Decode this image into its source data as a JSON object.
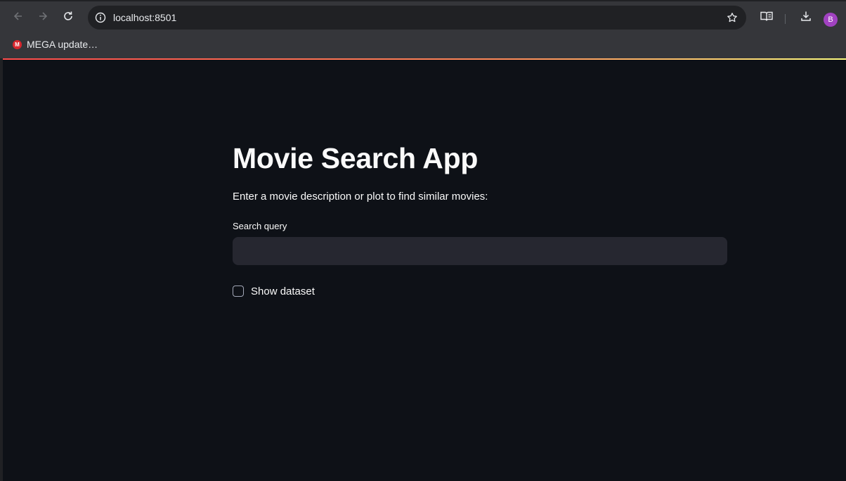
{
  "browser": {
    "url": "localhost:8501",
    "icons": {
      "back": "back-arrow-icon",
      "forward": "forward-arrow-icon",
      "reload": "reload-icon",
      "site_info": "site-info-icon",
      "bookmark_star": "star-icon",
      "reading_mode": "reading-mode-icon",
      "downloads": "download-icon"
    },
    "profile_initial": "B",
    "profile_color": "#a142c1"
  },
  "bookmarks": {
    "items": [
      {
        "label": "MEGA update…",
        "icon": "mega-icon",
        "icon_text": "M"
      }
    ]
  },
  "app": {
    "title": "Movie Search App",
    "description": "Enter a movie description or plot to find similar movies:",
    "search": {
      "label": "Search query",
      "value": "",
      "placeholder": ""
    },
    "show_dataset": {
      "label": "Show dataset",
      "checked": false
    },
    "colors": {
      "background": "#0e1117",
      "input_bg": "#262730",
      "accent": "#ff4b4b",
      "text": "#fafafa"
    }
  }
}
